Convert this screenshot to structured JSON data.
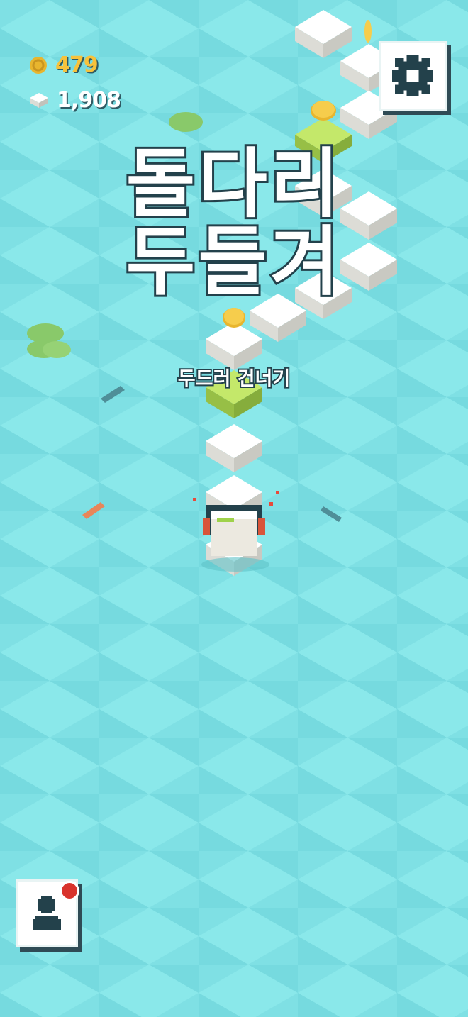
{
  "hud": {
    "coins": "479",
    "blocks": "1,908",
    "coin_icon": "coin-icon",
    "block_icon": "block-icon"
  },
  "title": {
    "line1": "돌다리",
    "line2": "두들겨"
  },
  "subtitle": "두드러 건너기",
  "buttons": {
    "settings_icon": "gear-icon",
    "profile_icon": "person-icon",
    "profile_badge": "notification-dot"
  },
  "colors": {
    "water": "#7fe0e4",
    "coin": "#f7c23b",
    "outline": "#23414b",
    "block_top": "#ffffff",
    "block_green": "#b9e05a",
    "badge": "#d8332c"
  }
}
